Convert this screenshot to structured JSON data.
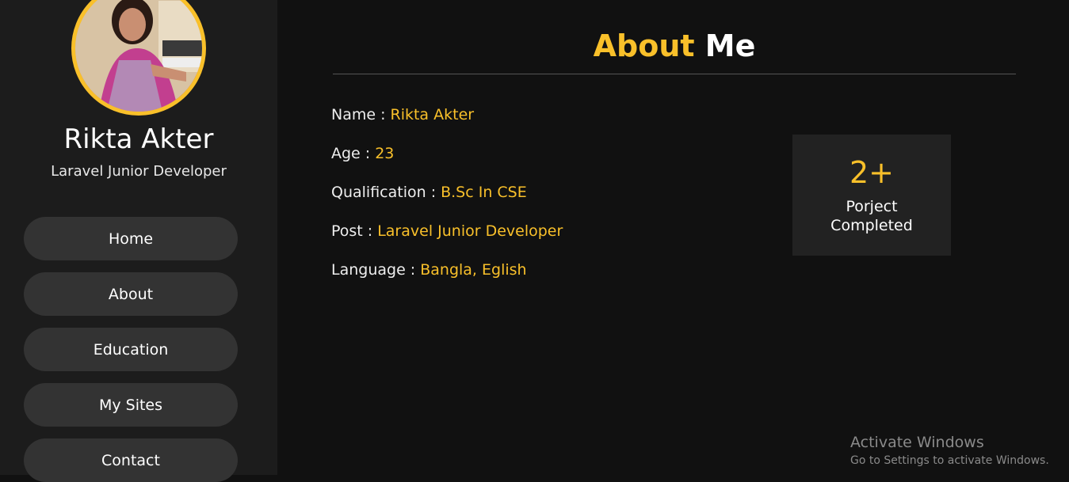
{
  "profile": {
    "name": "Rikta Akter",
    "role": "Laravel Junior Developer"
  },
  "nav": {
    "items": [
      {
        "label": "Home"
      },
      {
        "label": "About"
      },
      {
        "label": "Education"
      },
      {
        "label": "My Sites"
      },
      {
        "label": "Contact"
      }
    ]
  },
  "main": {
    "title_accent": "About",
    "title_rest": "Me",
    "info": [
      {
        "label": "Name :",
        "value": "Rikta Akter"
      },
      {
        "label": "Age :",
        "value": "23"
      },
      {
        "label": "Qualification :",
        "value": "B.Sc In CSE"
      },
      {
        "label": "Post :",
        "value": "Laravel Junior Developer"
      },
      {
        "label": "Language :",
        "value": "Bangla, Eglish"
      }
    ],
    "stat": {
      "value": "2+",
      "label_line1": "Porject",
      "label_line2": "Completed"
    }
  },
  "watermark": {
    "title": "Activate Windows",
    "subtitle": "Go to Settings to activate Windows."
  },
  "colors": {
    "accent": "#f9c02a",
    "background": "#111111",
    "sidebar": "#1c1c1c",
    "button": "#333333",
    "card": "#222222"
  }
}
